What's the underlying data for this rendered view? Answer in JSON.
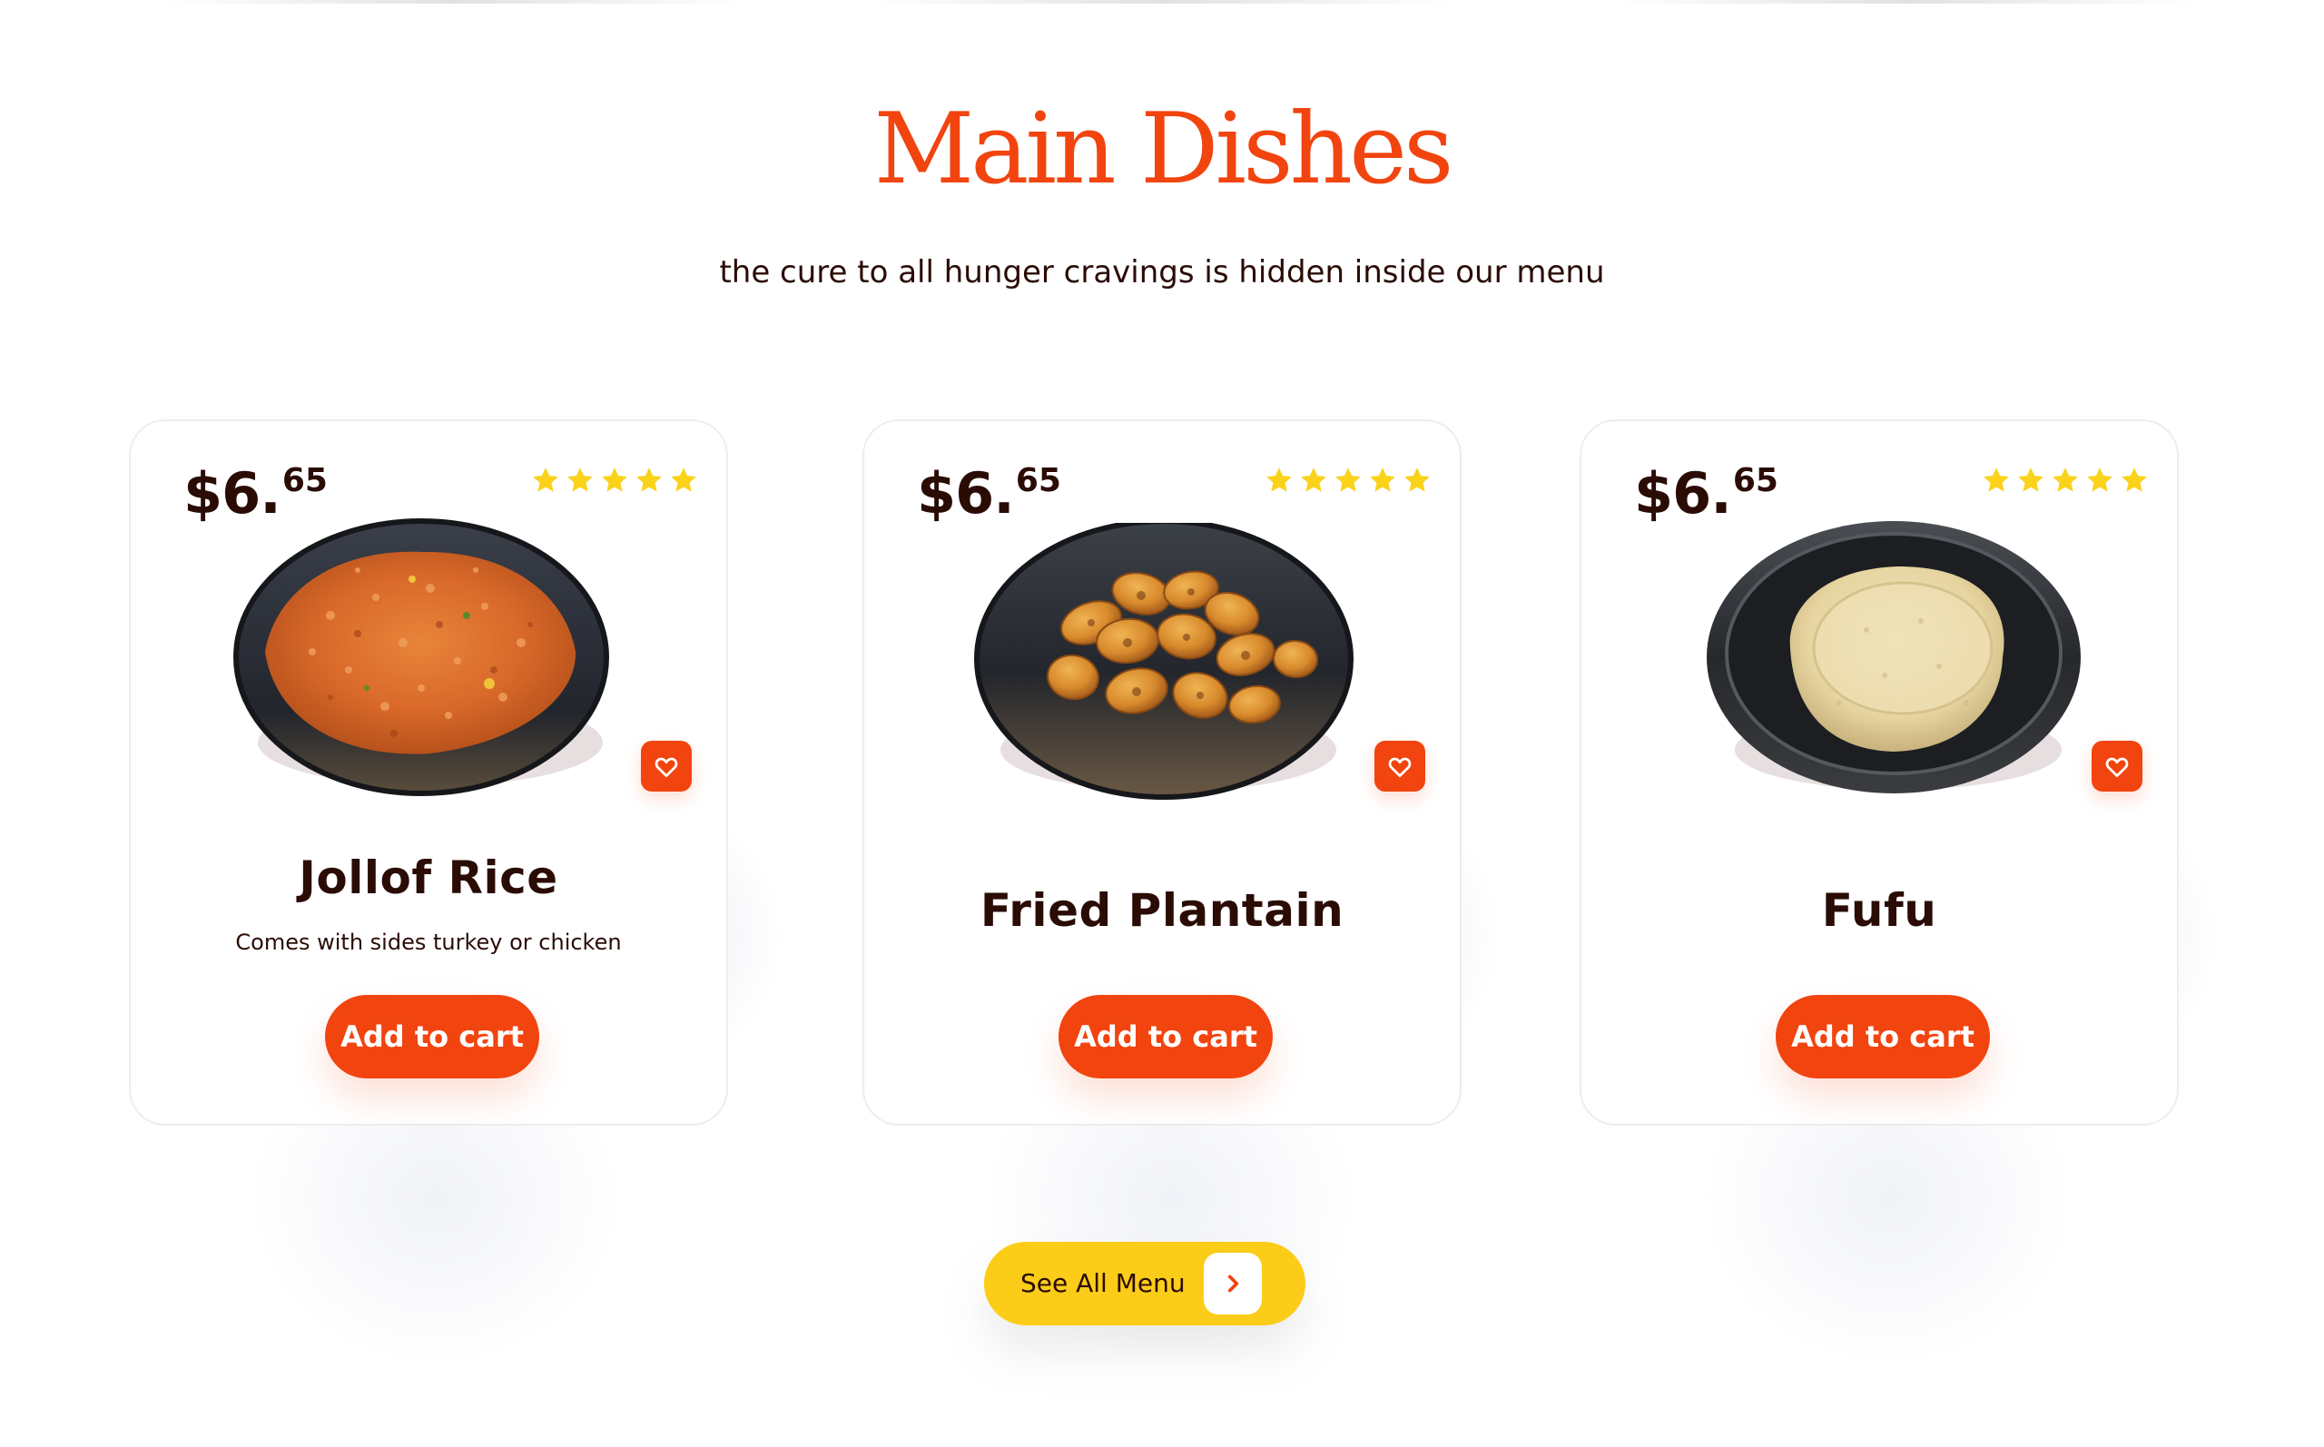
{
  "section": {
    "title": "Main Dishes",
    "subtitle": "the cure to all hunger cravings is hidden inside our menu"
  },
  "colors": {
    "accent": "#f2440f",
    "star": "#fbd21a",
    "cta_yellow": "#fbcd19",
    "text_dark": "#2a0c05"
  },
  "dishes": [
    {
      "name": "Jollof Rice",
      "description": "Comes with sides turkey or chicken",
      "price_main": "$6.",
      "price_cents": "65",
      "rating": 5,
      "image": "jollof-rice-plate-image",
      "favorite_icon": "heart-icon",
      "add_to_cart_label": "Add to cart"
    },
    {
      "name": "Fried Plantain",
      "description": "",
      "price_main": "$6.",
      "price_cents": "65",
      "rating": 5,
      "image": "fried-plantain-plate-image",
      "favorite_icon": "heart-icon",
      "add_to_cart_label": "Add to cart"
    },
    {
      "name": "Fufu",
      "description": "",
      "price_main": "$6.",
      "price_cents": "65",
      "rating": 5,
      "image": "fufu-bowl-image",
      "favorite_icon": "heart-icon",
      "add_to_cart_label": "Add to cart"
    }
  ],
  "see_all": {
    "label": "See All Menu",
    "icon": "chevron-right-icon"
  }
}
